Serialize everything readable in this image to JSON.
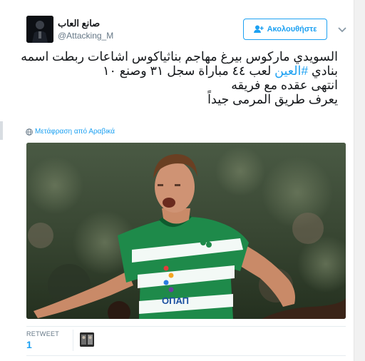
{
  "account": {
    "display_name": "صانع العاب",
    "handle": "@Attacking_M"
  },
  "follow_button": {
    "label": "Ακολουθήστε"
  },
  "tweet": {
    "lines": [
      "السويدي ماركوس بيرغ مهاجم بناثياكوس اشاعات ربطت اسمه",
      "بنادي",
      "لعب ٤٤ مباراة سجل ٣١ وصنع ١٠",
      "انتهى عقده مع فريقه",
      "يعرف طريق المرمى جيداً"
    ],
    "hashtag": "#العين"
  },
  "translate_link": "Μετάφραση από Αραβικά",
  "photo": {
    "jersey_sponsor": "OПАП"
  },
  "stats": {
    "retweet_label": "RETWEET",
    "retweet_count": "1"
  },
  "colors": {
    "accent": "#1da1f2",
    "text": "#14171a",
    "muted": "#657786",
    "jersey_green": "#1e8a4a"
  }
}
